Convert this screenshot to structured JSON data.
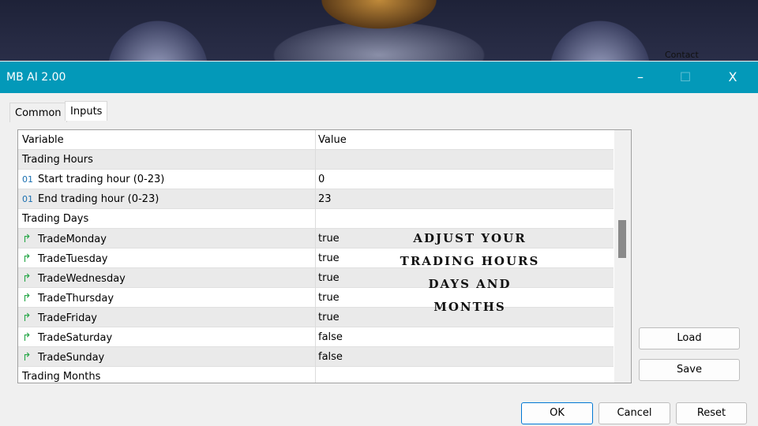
{
  "background": {
    "contact": "Contact"
  },
  "window": {
    "title": "MB AI 2.00",
    "minimize": "–",
    "maximize": "☐",
    "close": "X"
  },
  "tabs": [
    {
      "label": "Common"
    },
    {
      "label": "Inputs",
      "active": true
    }
  ],
  "grid": {
    "headers": [
      "Variable",
      "Value"
    ],
    "rows": [
      {
        "variable": "Trading Hours",
        "value": "",
        "type": "group"
      },
      {
        "variable": "Start trading hour (0-23)",
        "value": "0",
        "icon": "01"
      },
      {
        "variable": "End trading hour (0-23)",
        "value": "23",
        "icon": "01"
      },
      {
        "variable": "Trading Days",
        "value": "",
        "type": "group"
      },
      {
        "variable": "TradeMonday",
        "value": "true",
        "icon": "↱"
      },
      {
        "variable": "TradeTuesday",
        "value": "true",
        "icon": "↱"
      },
      {
        "variable": "TradeWednesday",
        "value": "true",
        "icon": "↱"
      },
      {
        "variable": "TradeThursday",
        "value": "true",
        "icon": "↱"
      },
      {
        "variable": "TradeFriday",
        "value": "true",
        "icon": "↱"
      },
      {
        "variable": "TradeSaturday",
        "value": "false",
        "icon": "↱"
      },
      {
        "variable": "TradeSunday",
        "value": "false",
        "icon": "↱"
      },
      {
        "variable": "Trading Months",
        "value": "",
        "type": "group"
      }
    ]
  },
  "overlay": [
    "ADJUST YOUR",
    "TRADING HOURS",
    "DAYS AND",
    "MONTHS"
  ],
  "buttons": {
    "load": "Load",
    "save": "Save",
    "ok": "OK",
    "cancel": "Cancel",
    "reset": "Reset"
  },
  "colors": {
    "titlebar": "#0399b9",
    "bool_icon": "#2aa84a",
    "int_icon": "#1a6fb0"
  }
}
